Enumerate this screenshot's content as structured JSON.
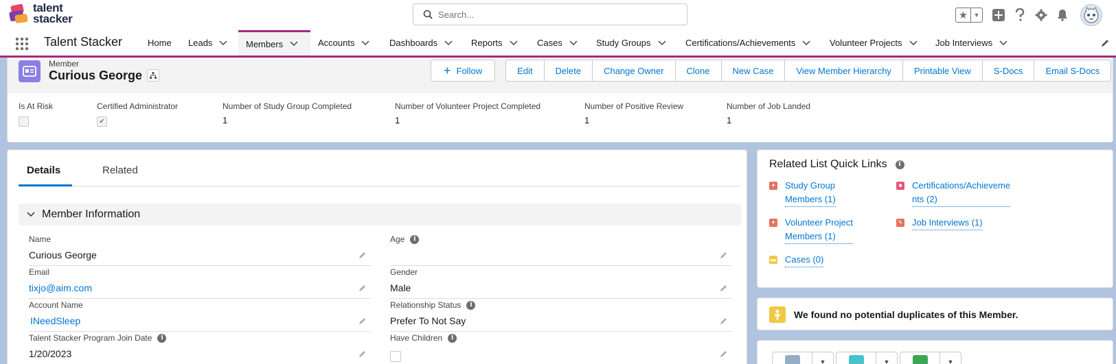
{
  "brand": {
    "line1": "talent",
    "line2": "stacker"
  },
  "search": {
    "placeholder": "Search..."
  },
  "nav": {
    "app_name": "Talent Stacker",
    "items": [
      {
        "label": "Home"
      },
      {
        "label": "Leads"
      },
      {
        "label": "Members"
      },
      {
        "label": "Accounts"
      },
      {
        "label": "Dashboards"
      },
      {
        "label": "Reports"
      },
      {
        "label": "Cases"
      },
      {
        "label": "Study Groups"
      },
      {
        "label": "Certifications/Achievements"
      },
      {
        "label": "Volunteer Projects"
      },
      {
        "label": "Job Interviews"
      }
    ],
    "active": "Members"
  },
  "record": {
    "type": "Member",
    "name": "Curious George",
    "actions": {
      "follow": "Follow",
      "edit": "Edit",
      "delete": "Delete",
      "change_owner": "Change Owner",
      "clone": "Clone",
      "new_case": "New Case",
      "view_hierarchy": "View Member Hierarchy",
      "printable_view": "Printable View",
      "sdocs": "S-Docs",
      "email_sdocs": "Email S-Docs"
    },
    "highlights": [
      {
        "label": "Is At Risk",
        "checked": false
      },
      {
        "label": "Certified Administrator",
        "checked": true
      },
      {
        "label": "Number of Study Group Completed",
        "value": "1"
      },
      {
        "label": "Number of Volunteer Project Completed",
        "value": "1"
      },
      {
        "label": "Number of Positive Review",
        "value": "1"
      },
      {
        "label": "Number of Job Landed",
        "value": "1"
      }
    ]
  },
  "tabs": {
    "details": "Details",
    "related": "Related"
  },
  "section": {
    "title": "Member Information"
  },
  "fields": {
    "name": {
      "label": "Name",
      "value": "Curious George"
    },
    "age": {
      "label": "Age",
      "value": ""
    },
    "email": {
      "label": "Email",
      "value": "tixjo@aim.com"
    },
    "gender": {
      "label": "Gender",
      "value": "Male"
    },
    "account": {
      "label": "Account Name",
      "value": "INeedSleep"
    },
    "relationship": {
      "label": "Relationship Status",
      "value": "Prefer To Not Say"
    },
    "join_date": {
      "label": "Talent Stacker Program Join Date",
      "value": "1/20/2023"
    },
    "children": {
      "label": "Have Children",
      "checked": false
    }
  },
  "quick_links": {
    "title": "Related List Quick Links",
    "links": [
      {
        "label": "Study Group\nMembers (1)",
        "color": "#e3735e"
      },
      {
        "label": "Certifications/Achieveme\nnts (2)",
        "color": "#e3577d"
      },
      {
        "label": "Volunteer Project\nMembers (1)",
        "color": "#e3735e"
      },
      {
        "label": "Job Interviews (1)",
        "color": "#e3735e"
      },
      {
        "label": "Cases (0)",
        "color": "#f2c94c"
      }
    ]
  },
  "duplicates": {
    "text": "We found no potential duplicates of this Member."
  },
  "colors": {
    "accent": "#a02a7f",
    "link": "#0176d3",
    "record_icon": "#8b7fe6"
  }
}
